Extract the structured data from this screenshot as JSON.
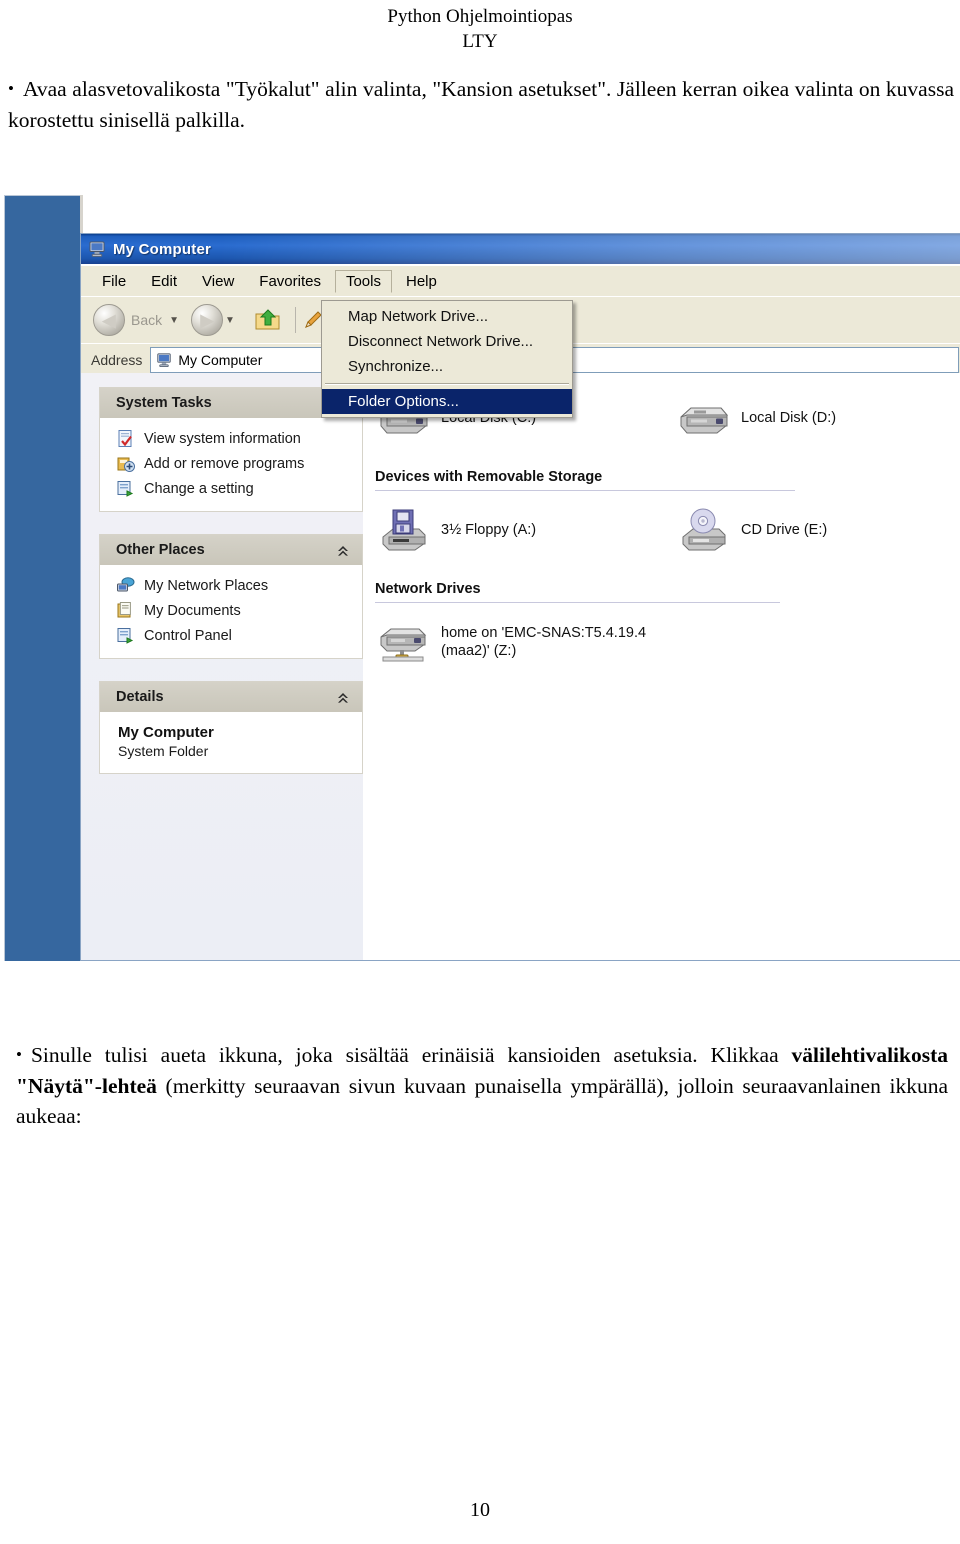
{
  "document": {
    "header_line1": "Python Ohjelmointiopas",
    "header_line2": "LTY",
    "page_number": "10",
    "paragraph_top_bullet": "•",
    "paragraph_top": "Avaa alasvetovalikosta \"Työkalut\" alin valinta, \"Kansion asetukset\". Jälleen kerran oikea valinta on kuvassa korostettu sinisellä palkilla.",
    "paragraph_bottom_bullet": "•",
    "paragraph_bottom_part1": "Sinulle tulisi aueta ikkuna, joka sisältää erinäisiä kansioiden asetuksia. Klikkaa ",
    "paragraph_bottom_bold": "välilehtivalikosta \"Näytä\"-lehteä",
    "paragraph_bottom_part2": " (merkitty seuraavan sivun kuvaan punaisella ympärällä), jolloin seuraavanlainen ikkuna aukeaa:"
  },
  "screenshot": {
    "window": {
      "title": "My Computer",
      "title_icon": "my-computer-icon",
      "titlebar_color": "#1f5fbe",
      "desktop_color": "#36679f",
      "chrome_color": "#ece9d8"
    },
    "menubar": {
      "items": [
        {
          "label": "File"
        },
        {
          "label": "Edit"
        },
        {
          "label": "View"
        },
        {
          "label": "Favorites"
        },
        {
          "label": "Tools"
        },
        {
          "label": "Help"
        }
      ],
      "open_index": 4
    },
    "toolbar": {
      "back_label": "Back",
      "back_icon": "back-arrow-icon",
      "forward_icon": "forward-arrow-icon",
      "up_icon": "up-folder-icon",
      "search_icon": "search-icon",
      "caret_glyph": "▼"
    },
    "address_bar": {
      "label": "Address",
      "value": "My Computer",
      "icon": "my-computer-icon"
    },
    "tools_menu": {
      "highlight_color": "#0a246a",
      "items": [
        {
          "label": "Map Network Drive...",
          "highlighted": false,
          "separator_after": false
        },
        {
          "label": "Disconnect Network Drive...",
          "highlighted": false,
          "separator_after": false
        },
        {
          "label": "Synchronize...",
          "highlighted": false,
          "separator_after": true
        },
        {
          "label": "Folder Options...",
          "highlighted": true,
          "separator_after": false
        }
      ]
    },
    "sidebar": {
      "panels": [
        {
          "title": "System Tasks",
          "collapse_icon": "chevron-up-icon",
          "items": [
            {
              "label": "View system information",
              "icon": "system-info-icon"
            },
            {
              "label": "Add or remove programs",
              "icon": "add-remove-programs-icon"
            },
            {
              "label": "Change a setting",
              "icon": "control-panel-icon"
            }
          ]
        },
        {
          "title": "Other Places",
          "collapse_icon": "chevron-up-icon",
          "items": [
            {
              "label": "My Network Places",
              "icon": "network-places-icon"
            },
            {
              "label": "My Documents",
              "icon": "my-documents-icon"
            },
            {
              "label": "Control Panel",
              "icon": "control-panel-icon"
            }
          ]
        }
      ],
      "details_panel": {
        "title": "Details",
        "collapse_icon": "chevron-up-icon",
        "primary": "My Computer",
        "secondary": "System Folder"
      }
    },
    "content": {
      "hard_drives": [
        {
          "label": "Local Disk (C:)",
          "icon": "hard-drive-icon"
        },
        {
          "label": "Local Disk (D:)",
          "icon": "hard-drive-icon"
        }
      ],
      "section_removable": "Devices with Removable Storage",
      "removable": [
        {
          "label": "3½ Floppy (A:)",
          "icon": "floppy-drive-icon"
        },
        {
          "label": "CD Drive (E:)",
          "icon": "cd-drive-icon"
        }
      ],
      "section_network": "Network Drives",
      "network": [
        {
          "label_line1": "home on 'EMC-SNAS:T5.4.19.4",
          "label_line2": "(maa2)' (Z:)",
          "icon": "network-drive-icon"
        }
      ]
    }
  }
}
